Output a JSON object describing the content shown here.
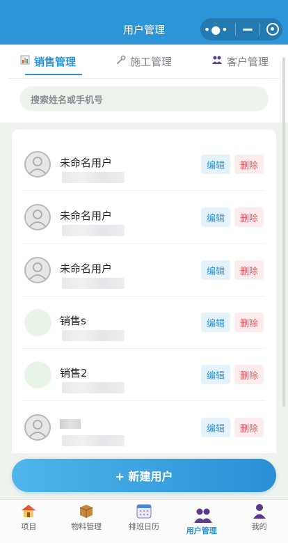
{
  "header": {
    "title": "用户管理"
  },
  "tabs": [
    {
      "label": "销售管理",
      "icon": "bar-chart-icon",
      "active": true
    },
    {
      "label": "施工管理",
      "icon": "wrench-icon",
      "active": false
    },
    {
      "label": "客户管理",
      "icon": "people-icon",
      "active": false
    }
  ],
  "search": {
    "placeholder": "搜索姓名或手机号"
  },
  "users": [
    {
      "name": "未命名用户",
      "avatar": "default-avatar-icon"
    },
    {
      "name": "未命名用户",
      "avatar": "default-avatar-icon"
    },
    {
      "name": "未命名用户",
      "avatar": "default-avatar-icon"
    },
    {
      "name": "销售s",
      "avatar": "blank-avatar"
    },
    {
      "name": "销售2",
      "avatar": "blank-avatar"
    },
    {
      "name": "",
      "avatar": "default-avatar-icon"
    }
  ],
  "actions": {
    "edit_label": "编辑",
    "delete_label": "删除"
  },
  "create_button": {
    "label": "+  新建用户"
  },
  "nav": [
    {
      "label": "项目",
      "icon": "house-icon"
    },
    {
      "label": "物料管理",
      "icon": "box-icon"
    },
    {
      "label": "排班日历",
      "icon": "calendar-icon"
    },
    {
      "label": "用户管理",
      "icon": "users-icon",
      "active": true
    },
    {
      "label": "我的",
      "icon": "person-icon"
    }
  ],
  "colors": {
    "primary": "#2b95d8",
    "delete": "#e35a62",
    "background": "#eef3ee"
  }
}
